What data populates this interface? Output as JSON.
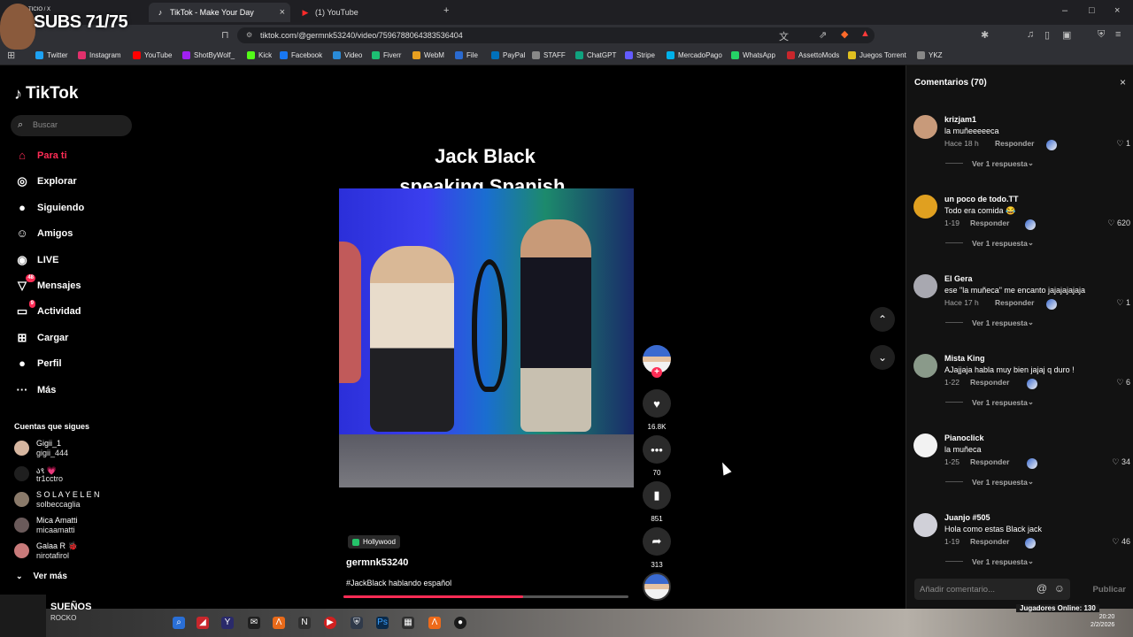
{
  "overlay": {
    "subs": "SUBS 71/75",
    "small": "TICIO / X"
  },
  "browser": {
    "tabs": [
      {
        "label": "TikTok - Make Your Day",
        "active": true
      },
      {
        "label": "(1) YouTube",
        "active": false
      }
    ],
    "url": "tiktok.com/@germnk53240/video/7596788064383536404",
    "bookmarks": [
      "Twitter",
      "Instagram",
      "YouTube",
      "ShotByWolf_",
      "Kick",
      "Facebook",
      "Video",
      "Fiverr",
      "WebM",
      "File",
      "PayPal",
      "STAFF",
      "ChatGPT",
      "Stripe",
      "MercadoPago",
      "WhatsApp",
      "AssettoMods",
      "Juegos Torrent",
      "YKZ"
    ]
  },
  "sidebar": {
    "logo": "TikTok",
    "search_placeholder": "Buscar",
    "nav": [
      {
        "label": "Para ti",
        "icon": "home-icon",
        "active": true
      },
      {
        "label": "Explorar",
        "icon": "compass-icon"
      },
      {
        "label": "Siguiendo",
        "icon": "following-icon"
      },
      {
        "label": "Amigos",
        "icon": "friends-icon"
      },
      {
        "label": "LIVE",
        "icon": "live-icon"
      },
      {
        "label": "Mensajes",
        "icon": "messages-icon",
        "badge": "48"
      },
      {
        "label": "Actividad",
        "icon": "activity-icon",
        "badge": "9"
      },
      {
        "label": "Cargar",
        "icon": "upload-icon"
      },
      {
        "label": "Perfil",
        "icon": "profile-icon"
      },
      {
        "label": "Más",
        "icon": "more-icon"
      }
    ],
    "following_title": "Cuentas que sigues",
    "following": [
      {
        "name": "Gigii_1",
        "handle": "gigii_444"
      },
      {
        "name": "ა९ 💗",
        "handle": "tr1cctro"
      },
      {
        "name": "S O L A Y E L E N",
        "handle": "solbeccaglia"
      },
      {
        "name": "Mica Amatti",
        "handle": "micaamatti"
      },
      {
        "name": "Galaa R 🐞",
        "handle": "nirotafirol"
      }
    ],
    "see_more": "Ver más"
  },
  "video": {
    "title_line1": "Jack Black",
    "title_line2": "speaking Spanish.",
    "tag": "Hollywood",
    "author": "germnk53240",
    "description": "#JackBlack hablando español",
    "progress": 0.63,
    "likes": "16.8K",
    "comments": "70",
    "saves": "851",
    "shares": "313"
  },
  "comments": {
    "title": "Comentarios (70)",
    "reply_label": "Responder",
    "view_replies": "Ver 1 respuesta",
    "items": [
      {
        "user": "krizjam1",
        "text": "la muñeeeeeca",
        "time": "Hace 18 h",
        "likes": "1"
      },
      {
        "user": "un poco de todo.TT",
        "text": "Todo era comida 😂",
        "time": "1-19",
        "likes": "620"
      },
      {
        "user": "El Gera",
        "text": "ese \"la muñeca\" me encanto jajajajajaja",
        "time": "Hace 17 h",
        "likes": "1"
      },
      {
        "user": "Mista King",
        "text": "AJajjaja habla muy bien jajaj q duro !",
        "time": "1-22",
        "likes": "6"
      },
      {
        "user": "Pianoclick",
        "text": "la muñeca",
        "time": "1-25",
        "likes": "34"
      },
      {
        "user": "Juanjo #505",
        "text": "Hola como estas Black jack",
        "time": "1-19",
        "likes": "46"
      }
    ],
    "input_placeholder": "Añadir comentario...",
    "publish": "Publicar"
  },
  "taskbar": {
    "music_title": "SUEÑOS",
    "music_artist": "ROCKO",
    "players": "Jugadores Online: 130",
    "time": "20:20",
    "date": "2/2/2026"
  }
}
